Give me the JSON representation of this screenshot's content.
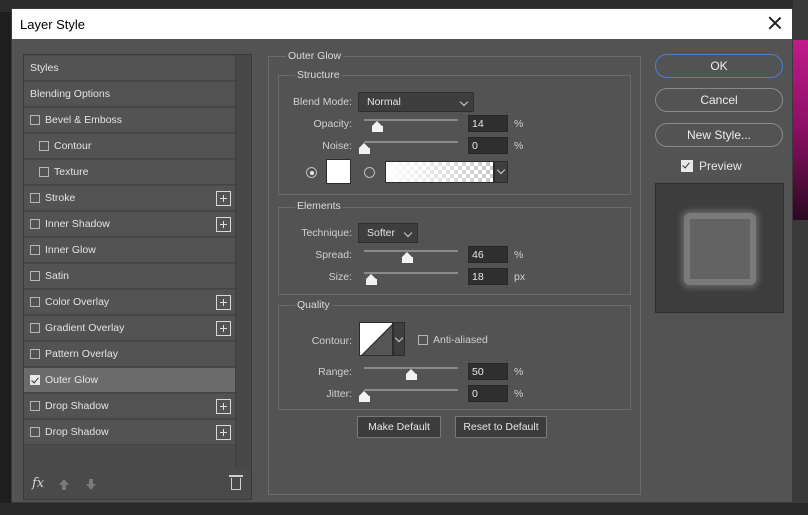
{
  "dialog": {
    "title": "Layer Style"
  },
  "styles_list": {
    "items": [
      {
        "label": "Styles",
        "checkbox": false,
        "checked": false,
        "indent": false,
        "plus": false,
        "selected": false
      },
      {
        "label": "Blending Options",
        "checkbox": false,
        "checked": false,
        "indent": false,
        "plus": false,
        "selected": false
      },
      {
        "label": "Bevel & Emboss",
        "checkbox": true,
        "checked": false,
        "indent": false,
        "plus": false,
        "selected": false
      },
      {
        "label": "Contour",
        "checkbox": true,
        "checked": false,
        "indent": true,
        "plus": false,
        "selected": false
      },
      {
        "label": "Texture",
        "checkbox": true,
        "checked": false,
        "indent": true,
        "plus": false,
        "selected": false
      },
      {
        "label": "Stroke",
        "checkbox": true,
        "checked": false,
        "indent": false,
        "plus": true,
        "selected": false
      },
      {
        "label": "Inner Shadow",
        "checkbox": true,
        "checked": false,
        "indent": false,
        "plus": true,
        "selected": false
      },
      {
        "label": "Inner Glow",
        "checkbox": true,
        "checked": false,
        "indent": false,
        "plus": false,
        "selected": false
      },
      {
        "label": "Satin",
        "checkbox": true,
        "checked": false,
        "indent": false,
        "plus": false,
        "selected": false
      },
      {
        "label": "Color Overlay",
        "checkbox": true,
        "checked": false,
        "indent": false,
        "plus": true,
        "selected": false
      },
      {
        "label": "Gradient Overlay",
        "checkbox": true,
        "checked": false,
        "indent": false,
        "plus": true,
        "selected": false
      },
      {
        "label": "Pattern Overlay",
        "checkbox": true,
        "checked": false,
        "indent": false,
        "plus": false,
        "selected": false
      },
      {
        "label": "Outer Glow",
        "checkbox": true,
        "checked": true,
        "indent": false,
        "plus": false,
        "selected": true
      },
      {
        "label": "Drop Shadow",
        "checkbox": true,
        "checked": false,
        "indent": false,
        "plus": true,
        "selected": false
      },
      {
        "label": "Drop Shadow",
        "checkbox": true,
        "checked": false,
        "indent": false,
        "plus": true,
        "selected": false
      }
    ],
    "fx_label": "fx"
  },
  "outer_glow": {
    "title": "Outer Glow",
    "structure": {
      "title": "Structure",
      "blend_mode_label": "Blend Mode:",
      "blend_mode_value": "Normal",
      "opacity_label": "Opacity:",
      "opacity_value": "14",
      "opacity_unit": "%",
      "opacity_level": 0.14,
      "noise_label": "Noise:",
      "noise_value": "0",
      "noise_unit": "%",
      "noise_level": 0.0,
      "color_mode": "solid",
      "glow_color": "#ffffff"
    },
    "elements": {
      "title": "Elements",
      "technique_label": "Technique:",
      "technique_value": "Softer",
      "spread_label": "Spread:",
      "spread_value": "46",
      "spread_unit": "%",
      "spread_level": 0.46,
      "size_label": "Size:",
      "size_value": "18",
      "size_unit": "px",
      "size_level": 0.072
    },
    "quality": {
      "title": "Quality",
      "contour_label": "Contour:",
      "anti_aliased_label": "Anti-aliased",
      "anti_aliased": false,
      "range_label": "Range:",
      "range_value": "50",
      "range_unit": "%",
      "range_level": 0.5,
      "jitter_label": "Jitter:",
      "jitter_value": "0",
      "jitter_unit": "%",
      "jitter_level": 0.0
    },
    "make_default_label": "Make Default",
    "reset_default_label": "Reset to Default"
  },
  "actions": {
    "ok_label": "OK",
    "cancel_label": "Cancel",
    "new_style_label": "New Style...",
    "preview_label": "Preview",
    "preview_checked": true
  },
  "colors": {
    "dialog_bg": "#535353",
    "selected_item": "#6b6b6b",
    "ok_border": "#4a7fd8",
    "title_bar": "#ffffff"
  }
}
